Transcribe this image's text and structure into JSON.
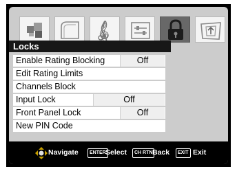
{
  "tabs": [
    {
      "name": "picture",
      "icon": "picture-icon",
      "active": false
    },
    {
      "name": "sound",
      "icon": "speaker-icon",
      "active": false
    },
    {
      "name": "audio",
      "icon": "music-note-icon",
      "active": false
    },
    {
      "name": "setup",
      "icon": "setup-icon",
      "active": false
    },
    {
      "name": "locks",
      "icon": "lock-icon",
      "active": true
    },
    {
      "name": "applications",
      "icon": "applications-icon",
      "active": false
    }
  ],
  "menu": {
    "title": "Locks",
    "items": [
      {
        "label": "Enable Rating Blocking",
        "value": "Off"
      },
      {
        "label": "Edit Rating Limits"
      },
      {
        "label": "Channels Block"
      },
      {
        "label": "Input Lock",
        "value": "Off"
      },
      {
        "label": "Front Panel Lock",
        "value": "Off"
      },
      {
        "label": "New PIN Code"
      }
    ]
  },
  "navbar": {
    "navigate_label": "Navigate",
    "enter_key": "ENTER",
    "select_label": "Select",
    "ch_rtn_key": "CH RTN",
    "back_label": "Back",
    "exit_key": "EXIT",
    "exit_label": "Exit"
  },
  "colors": {
    "panel_background": "#cccccc",
    "title_bar": "#171717",
    "active_tab": "#686868"
  }
}
